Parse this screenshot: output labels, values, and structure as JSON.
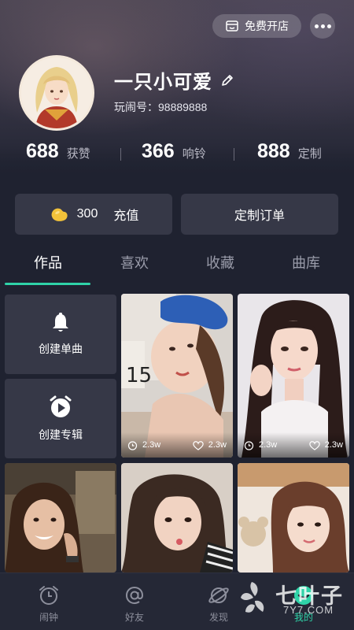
{
  "header": {
    "shop_label": "免费开店",
    "username": "一只小可爱",
    "userid": "玩闹号：98889888"
  },
  "stats": [
    {
      "value": "688",
      "label": "获赞"
    },
    {
      "value": "366",
      "label": "响铃"
    },
    {
      "value": "888",
      "label": "定制"
    }
  ],
  "actions": {
    "beans": "300",
    "recharge": "充值",
    "custom_order": "定制订单"
  },
  "tabs": [
    "作品",
    "喜欢",
    "收藏",
    "曲库"
  ],
  "create": {
    "single": "创建单曲",
    "album": "创建专辑"
  },
  "tiles": [
    {
      "alarms": "2.3w",
      "likes": "2.3w"
    },
    {
      "alarms": "2.3w",
      "likes": "2.3w"
    }
  ],
  "nav": [
    "闹钟",
    "好友",
    "发现",
    "我的"
  ],
  "watermark": {
    "text": "七叶子",
    "sub": "7Y7.COM"
  },
  "colors": {
    "accent": "#2fd3a8",
    "background": "#1f2230",
    "card": "#363847"
  }
}
